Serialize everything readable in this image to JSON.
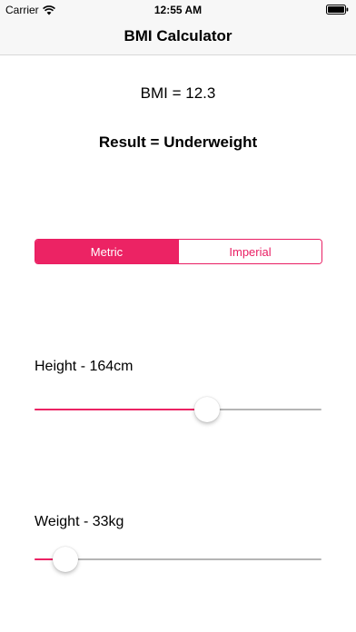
{
  "status_bar": {
    "carrier": "Carrier",
    "time": "12:55 AM"
  },
  "nav": {
    "title": "BMI Calculator"
  },
  "bmi": {
    "value_text": "BMI = 12.3",
    "result_text": "Result = Underweight"
  },
  "units": {
    "options": [
      "Metric",
      "Imperial"
    ],
    "selected": "Metric"
  },
  "height": {
    "label": "Height - 164cm",
    "fraction": 0.61
  },
  "weight": {
    "label": "Weight - 33kg",
    "fraction": 0.07
  },
  "colors": {
    "accent": "#ec2364",
    "track": "#b5b5b5"
  }
}
